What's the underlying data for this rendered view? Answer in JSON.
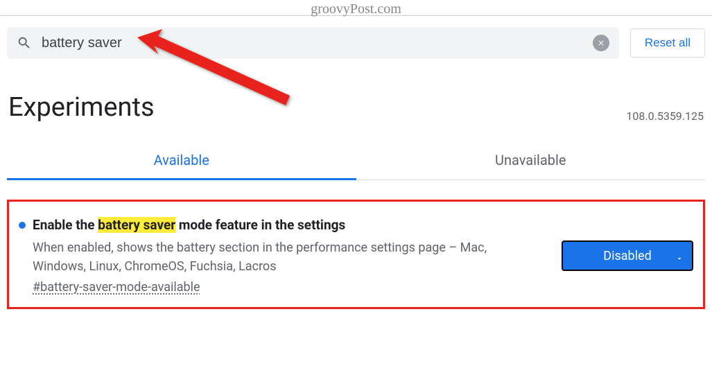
{
  "watermark": "groovyPost.com",
  "search": {
    "value": "battery saver"
  },
  "reset_label": "Reset all",
  "page_title": "Experiments",
  "version": "108.0.5359.125",
  "tabs": {
    "available": "Available",
    "unavailable": "Unavailable"
  },
  "experiment": {
    "title_pre": "Enable the ",
    "title_hl": "battery saver",
    "title_post": " mode feature in the settings",
    "description": "When enabled, shows the battery section in the performance settings page – Mac, Windows, Linux, ChromeOS, Fuchsia, Lacros",
    "tag": "#battery-saver-mode-available",
    "state": "Disabled"
  }
}
